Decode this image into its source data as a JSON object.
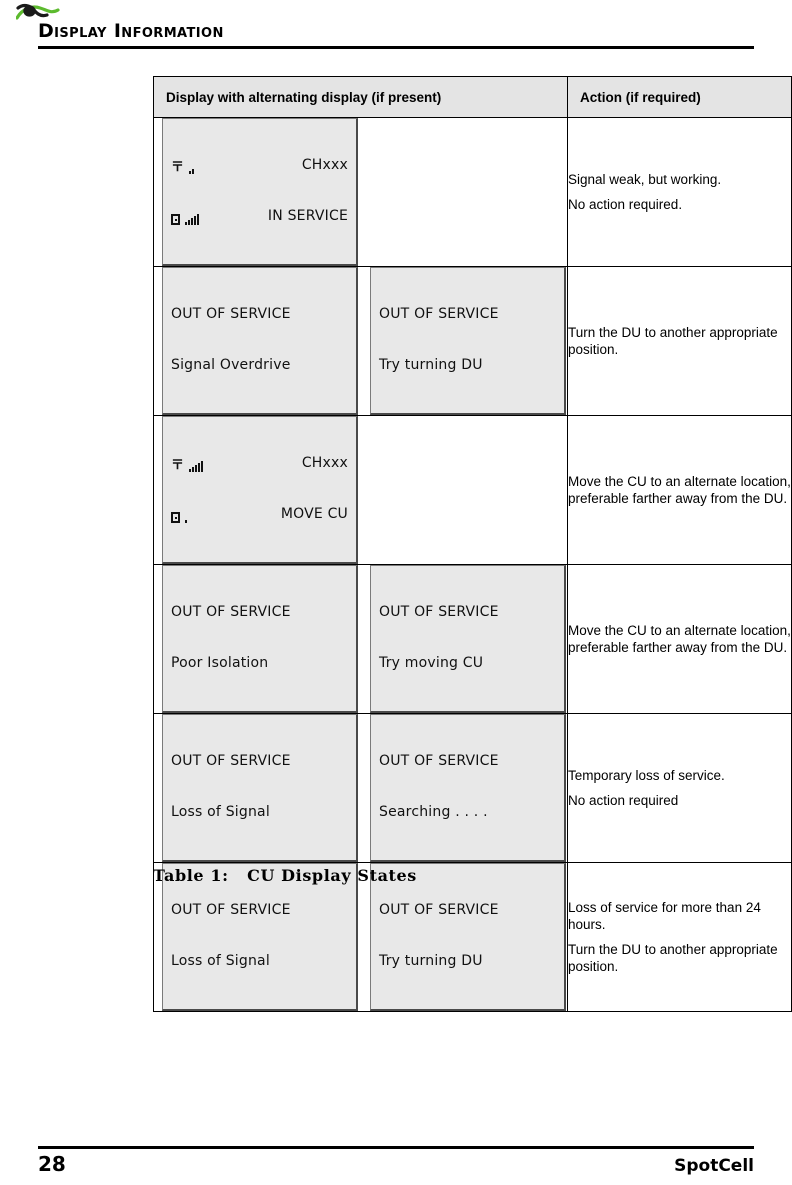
{
  "header": {
    "title": "Display Information",
    "logo_icon": "spotcell-swoosh-logo"
  },
  "table": {
    "columns": [
      "Display with alternating display (if present)",
      "Action (if required)"
    ],
    "rows": [
      {
        "display": {
          "type": "status-lcd",
          "top_left_icon": "antenna-icon",
          "top_left_bars": 2,
          "top_right": "CHxxx",
          "bottom_left_icon": "device-icon",
          "bottom_left_bars": 5,
          "bottom_right": "IN SERVICE"
        },
        "alternate": null,
        "action": [
          "Signal weak, but working.",
          "No action required."
        ]
      },
      {
        "display": {
          "type": "text-lcd",
          "line1": "OUT OF SERVICE",
          "line2": "Signal Overdrive"
        },
        "alternate": {
          "type": "text-lcd",
          "line1": "OUT OF SERVICE",
          "line2": "Try turning DU"
        },
        "action": [
          "Turn the DU to another appropriate position."
        ]
      },
      {
        "display": {
          "type": "status-lcd",
          "top_left_icon": "antenna-icon",
          "top_left_bars": 5,
          "top_right": "CHxxx",
          "bottom_left_icon": "device-icon",
          "bottom_left_bars": 1,
          "bottom_right": "MOVE CU"
        },
        "alternate": null,
        "action": [
          "Move the CU to an alternate location, preferable farther away from the DU."
        ]
      },
      {
        "display": {
          "type": "text-lcd",
          "line1": "OUT OF SERVICE",
          "line2": "Poor Isolation"
        },
        "alternate": {
          "type": "text-lcd",
          "line1": "OUT OF SERVICE",
          "line2": "Try moving CU"
        },
        "action": [
          "Move the CU to an alternate location, preferable farther away from the DU."
        ]
      },
      {
        "display": {
          "type": "text-lcd",
          "line1": "OUT OF SERVICE",
          "line2": "Loss of Signal"
        },
        "alternate": {
          "type": "text-lcd",
          "line1": "OUT OF SERVICE",
          "line2": "Searching . . . ."
        },
        "action": [
          "Temporary loss of service.",
          "No action required"
        ]
      },
      {
        "display": {
          "type": "text-lcd",
          "line1": "OUT OF SERVICE",
          "line2": "Loss of Signal"
        },
        "alternate": {
          "type": "text-lcd",
          "line1": "OUT OF SERVICE",
          "line2": "Try turning DU"
        },
        "action": [
          "Loss of service for more than 24 hours.",
          "Turn the DU to another appropriate position."
        ]
      }
    ],
    "caption": "Table 1:   CU Display States"
  },
  "footer": {
    "page_number": "28",
    "brand": "SpotCell"
  },
  "colors": {
    "header_band": "#e4e4e4",
    "lcd_background": "#e8e8e8",
    "rule": "#000000",
    "logo_green": "#5cba2e",
    "logo_black": "#1a1a1a"
  }
}
